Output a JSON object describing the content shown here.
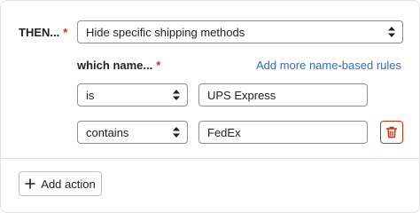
{
  "action": {
    "label": "THEN...",
    "required_mark": "*",
    "selected": "Hide specific shipping methods"
  },
  "name_rules": {
    "label": "which name...",
    "required_mark": "*",
    "add_link": "Add more name-based rules",
    "rules": [
      {
        "operator": "is",
        "value": "UPS Express"
      },
      {
        "operator": "contains",
        "value": "FedEx"
      }
    ]
  },
  "footer": {
    "add_action_label": "Add action"
  },
  "icons": {
    "select": "select-arrows-icon",
    "delete": "trash-icon",
    "add": "plus-icon"
  },
  "colors": {
    "required": "#d72c0d",
    "link": "#2c6ecb",
    "danger": "#d72c0d",
    "border": "#8c9196"
  }
}
